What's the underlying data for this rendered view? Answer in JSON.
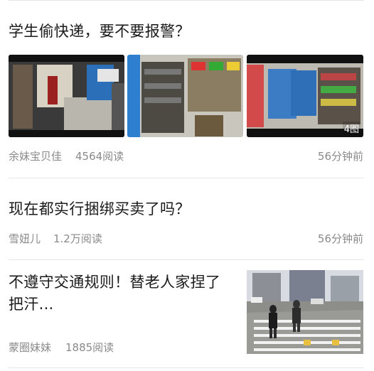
{
  "articles": [
    {
      "title": "学生偷快递，要不要报警？",
      "author": "余妹宝贝佳",
      "reads": "4564阅读",
      "time": "56分钟前",
      "image_count_badge": "4图"
    },
    {
      "title": "现在都实行捆绑买卖了吗？",
      "author": "雪妞儿",
      "reads": "1.2万阅读",
      "time": "56分钟前"
    },
    {
      "title_line1": "不遵守交通规则！替老人家捏了",
      "title_line2": "把汗...",
      "author": "蒙圈妹妹",
      "reads": "1885阅读"
    }
  ]
}
